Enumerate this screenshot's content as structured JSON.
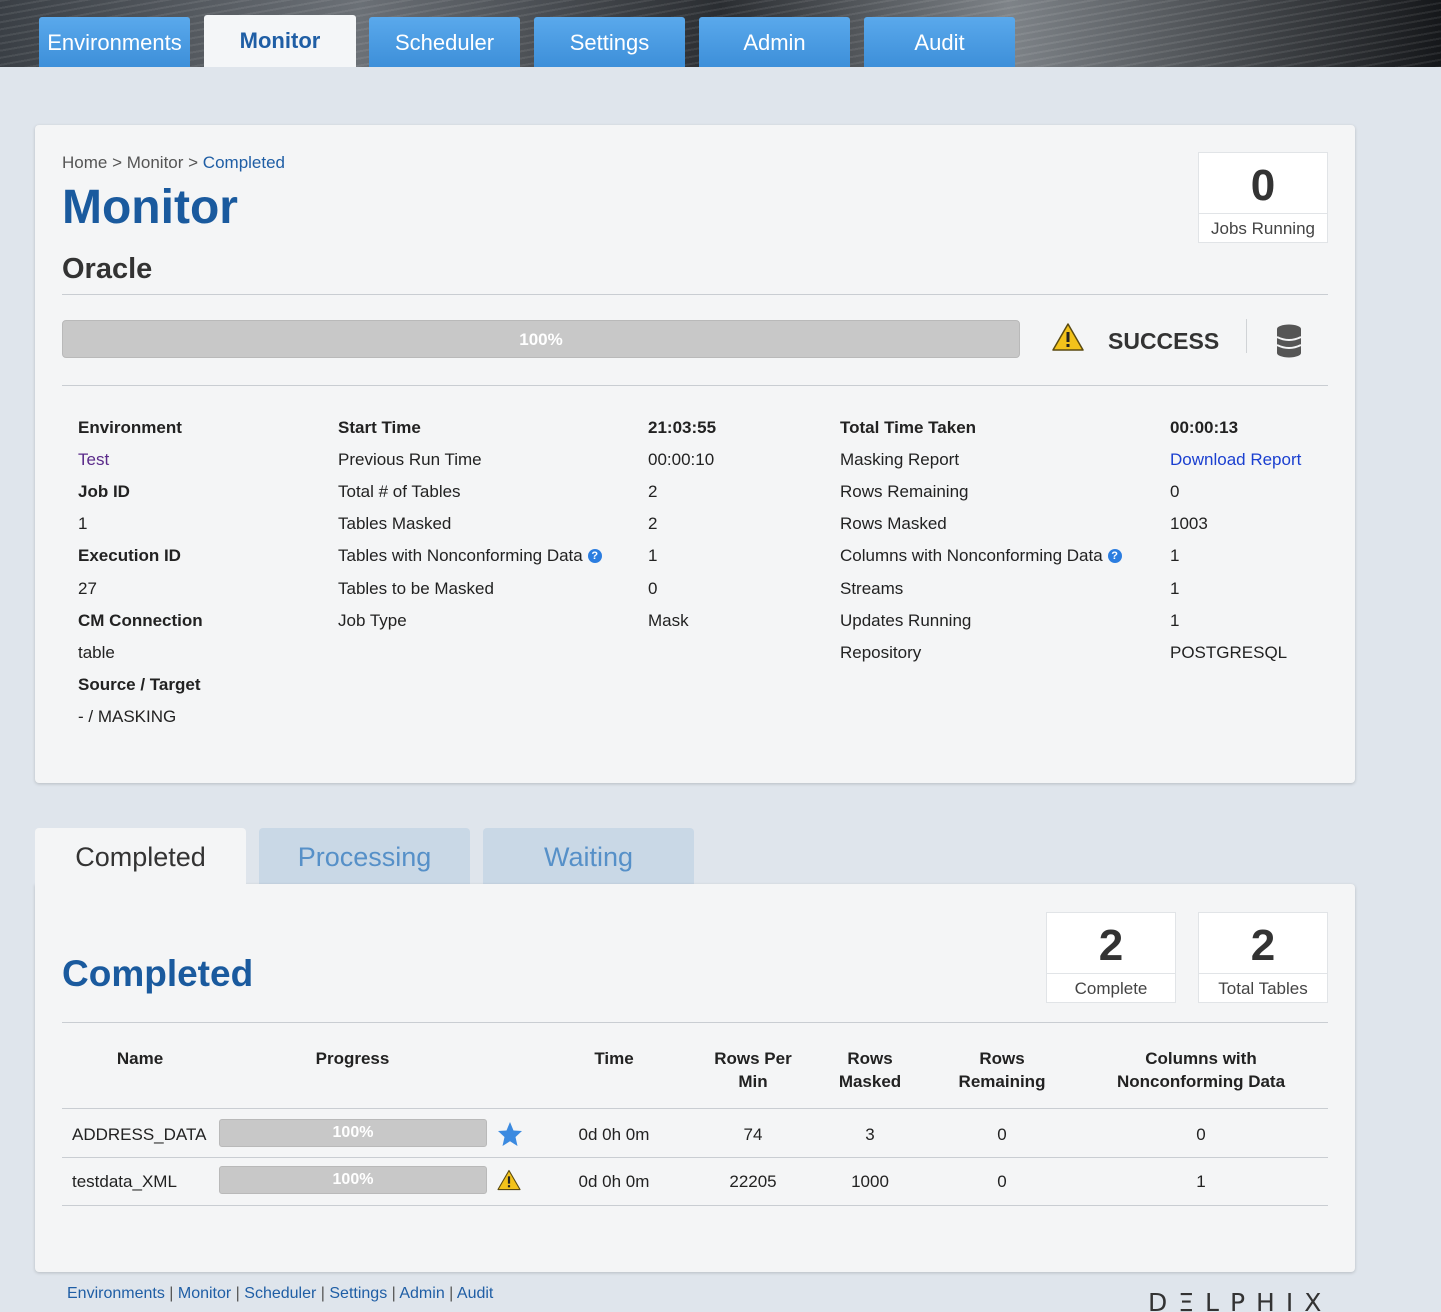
{
  "nav": {
    "tabs": [
      {
        "label": "Environments"
      },
      {
        "label": "Monitor"
      },
      {
        "label": "Scheduler"
      },
      {
        "label": "Settings"
      },
      {
        "label": "Admin"
      },
      {
        "label": "Audit"
      }
    ],
    "active": "Monitor"
  },
  "breadcrumb": {
    "home": "Home",
    "sep1": " > ",
    "monitor": "Monitor",
    "sep2": " > ",
    "current": "Completed"
  },
  "page_title": "Monitor",
  "job_name": "Oracle",
  "jobs_running": {
    "value": "0",
    "label": "Jobs Running"
  },
  "job_progress": {
    "label": "100%",
    "fraction": 1.0
  },
  "status": {
    "text": "SUCCESS",
    "icon": "warning-icon",
    "db_icon": "database-icon"
  },
  "details": {
    "col1": [
      {
        "label": "Environment",
        "value": "Test"
      },
      {
        "label": "Job ID",
        "value": "1"
      },
      {
        "label": "Execution ID",
        "value": "27"
      },
      {
        "label": "CM Connection",
        "value": "table"
      },
      {
        "label": "Source / Target",
        "value": "- / MASKING"
      }
    ],
    "col2": [
      {
        "label": "Start Time",
        "value": "21:03:55"
      },
      {
        "label": "Previous Run Time",
        "value": "00:00:10"
      },
      {
        "label": "Total # of Tables",
        "value": "2"
      },
      {
        "label": "Tables Masked",
        "value": "2"
      },
      {
        "label": "Tables with Nonconforming Data",
        "value": "1",
        "help": "?"
      },
      {
        "label": "Tables to be Masked",
        "value": "0"
      },
      {
        "label": "Job Type",
        "value": "Mask"
      }
    ],
    "col3": [
      {
        "label": "Total Time Taken",
        "value": "00:00:13"
      },
      {
        "label": "Masking Report",
        "value": "Download Report"
      },
      {
        "label": "Rows Remaining",
        "value": "0"
      },
      {
        "label": "Rows Masked",
        "value": "1003"
      },
      {
        "label": "Columns with Nonconforming Data",
        "value": "1",
        "help": "?"
      },
      {
        "label": "Streams",
        "value": "1"
      },
      {
        "label": "Updates Running",
        "value": "1"
      },
      {
        "label": "Repository",
        "value": "POSTGRESQL"
      }
    ]
  },
  "lower_tabs": [
    {
      "label": "Completed"
    },
    {
      "label": "Processing"
    },
    {
      "label": "Waiting"
    }
  ],
  "completed": {
    "title": "Completed",
    "complete_count": {
      "value": "2",
      "label": "Complete"
    },
    "total_tables": {
      "value": "2",
      "label": "Total Tables"
    },
    "columns": {
      "name": "Name",
      "progress": "Progress",
      "time": "Time",
      "rows_per_min_1": "Rows Per",
      "rows_per_min_2": "Min",
      "rows_masked_1": "Rows",
      "rows_masked_2": "Masked",
      "rows_remaining_1": "Rows",
      "rows_remaining_2": "Remaining",
      "nonconf_1": "Columns with",
      "nonconf_2": "Nonconforming Data"
    },
    "rows": [
      {
        "name": "ADDRESS_DATA",
        "progress": "100%",
        "progress_fraction": 1.0,
        "icon": "star-icon",
        "time": "0d 0h 0m",
        "rows_per_min": "74",
        "rows_masked": "3",
        "rows_remaining": "0",
        "nonconforming": "0"
      },
      {
        "name": "testdata_XML",
        "progress": "100%",
        "progress_fraction": 1.0,
        "icon": "warning-icon",
        "time": "0d 0h 0m",
        "rows_per_min": "22205",
        "rows_masked": "1000",
        "rows_remaining": "0",
        "nonconforming": "1"
      }
    ]
  },
  "footer": {
    "links": [
      {
        "label": "Environments"
      },
      {
        "label": "Monitor"
      },
      {
        "label": "Scheduler"
      },
      {
        "label": "Settings"
      },
      {
        "label": "Admin"
      },
      {
        "label": "Audit"
      }
    ],
    "sep": " | ",
    "logo": "DΞLPHIX"
  }
}
